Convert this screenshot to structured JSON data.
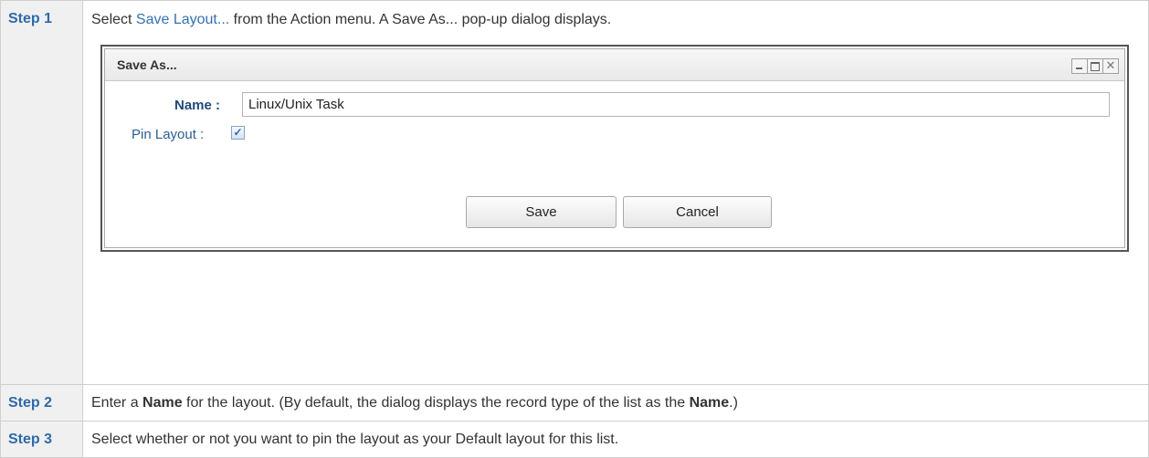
{
  "steps": [
    {
      "label": "Step 1",
      "text_before_link": "Select ",
      "link": "Save Layout...",
      "text_after_link": " from the Action menu. A Save As... pop-up dialog displays."
    },
    {
      "label": "Step 2",
      "text_a": "Enter a ",
      "bold_a": "Name",
      "text_b": " for the layout. (By default, the dialog displays the record type of the list as the ",
      "bold_b": "Name",
      "text_c": ".)"
    },
    {
      "label": "Step 3",
      "text": "Select whether or not you want to pin the layout as your Default layout for this list."
    }
  ],
  "dialog": {
    "title": "Save As...",
    "window_icons": [
      "minimize-icon",
      "maximize-icon",
      "close-icon"
    ],
    "name_label": "Name :",
    "name_value": "Linux/Unix Task",
    "pin_label": "Pin Layout :",
    "pin_checked": true,
    "save_label": "Save",
    "cancel_label": "Cancel"
  }
}
